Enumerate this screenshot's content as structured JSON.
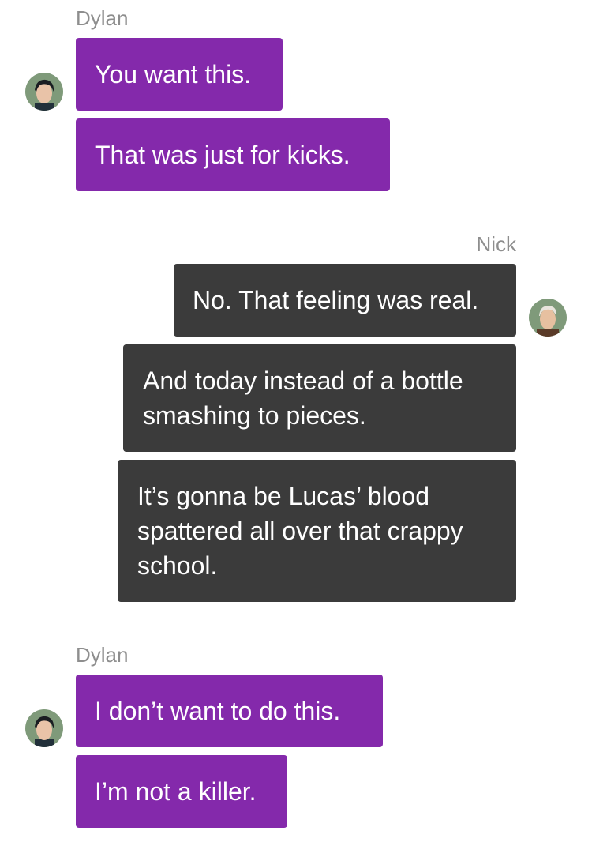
{
  "colors": {
    "dylan_bubble": "#8429ab",
    "nick_bubble": "#3b3b3b",
    "sender_name": "#8e8e8e",
    "text": "#ffffff"
  },
  "groups": [
    {
      "sender": "Dylan",
      "avatar_icon": "dylan-avatar-icon",
      "messages": [
        "You want this.",
        "That was just for kicks."
      ]
    },
    {
      "sender": "Nick",
      "avatar_icon": "nick-avatar-icon",
      "messages": [
        "No. That feeling was real.",
        "And today instead of a bottle\nsmashing to pieces.",
        "It’s gonna be Lucas’ blood\nspattered all over that crappy\nschool."
      ]
    },
    {
      "sender": "Dylan",
      "avatar_icon": "dylan-avatar-icon",
      "messages": [
        "I don’t want to do this.",
        "I’m not a killer."
      ]
    }
  ]
}
